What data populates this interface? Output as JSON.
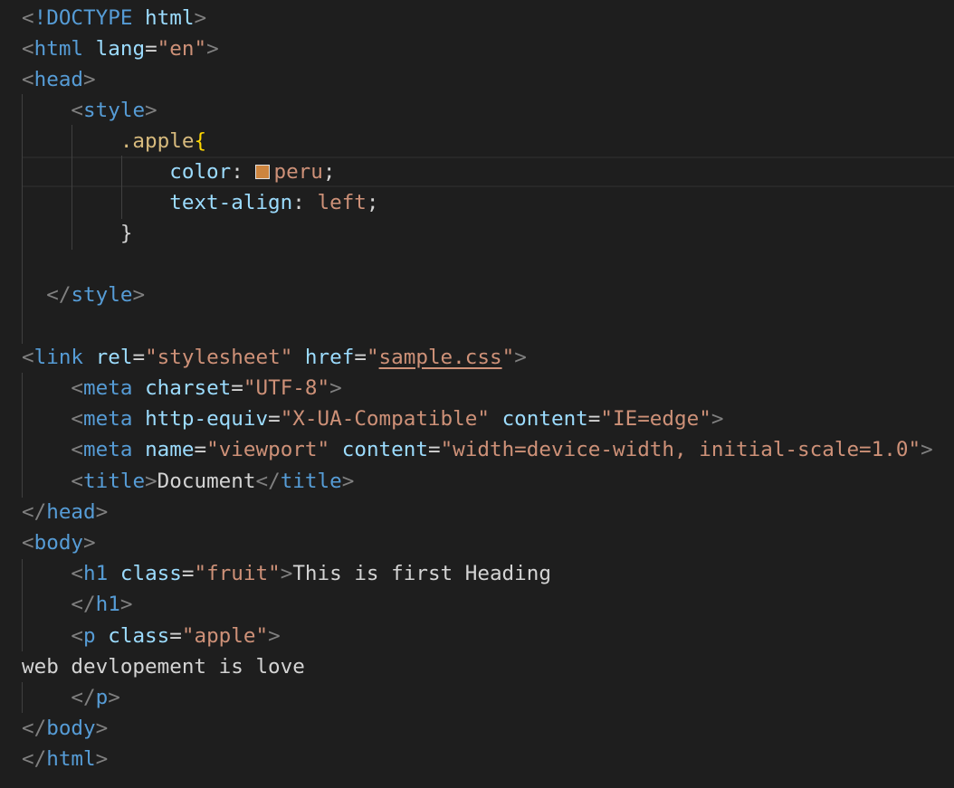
{
  "colors": {
    "background": "#1e1e1e",
    "tag": "#569cd6",
    "attribute": "#9cdcfe",
    "string": "#ce9178",
    "selector": "#d7ba7d",
    "text": "#d4d4d4",
    "punctuation": "#808080",
    "peru_swatch": "#cd853f"
  },
  "code": {
    "doctype": "!DOCTYPE",
    "html": "html",
    "lang_attr": "lang",
    "lang_val": "\"en\"",
    "head": "head",
    "style": "style",
    "selector": ".apple",
    "open_brace": "{",
    "close_brace": "}",
    "color_prop": "color",
    "color_val": "peru",
    "align_prop": "text-align",
    "align_val": "left",
    "link": "link",
    "rel_attr": "rel",
    "rel_val": "\"stylesheet\"",
    "href_attr": "href",
    "href_quote": "\"",
    "href_val": "sample.css",
    "meta": "meta",
    "charset_attr": "charset",
    "charset_val": "\"UTF-8\"",
    "httpequiv_attr": "http-equiv",
    "httpequiv_val": "\"X-UA-Compatible\"",
    "content_attr": "content",
    "ie_val": "\"IE=edge\"",
    "name_attr": "name",
    "viewport_val": "\"viewport\"",
    "viewport_content": "\"width=device-width, initial-scale=1.0\"",
    "title": "title",
    "title_text": "Document",
    "body": "body",
    "h1": "h1",
    "class_attr": "class",
    "fruit_val": "\"fruit\"",
    "h1_text": "This is first Heading",
    "p": "p",
    "apple_val": "\"apple\"",
    "p_text": "web devlopement is love"
  }
}
